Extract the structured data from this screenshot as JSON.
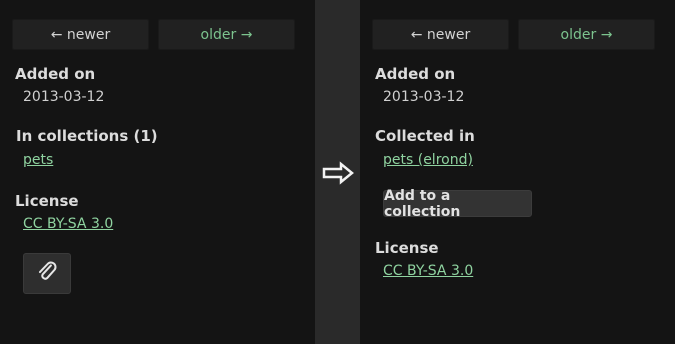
{
  "left": {
    "nav": {
      "newer": "← newer",
      "older": "older →"
    },
    "added_on": {
      "heading": "Added on",
      "value": "2013-03-12"
    },
    "collections": {
      "heading": "In collections (1)",
      "link": "pets"
    },
    "license": {
      "heading": "License",
      "link": "CC BY-SA 3.0"
    },
    "attach_icon": "paperclip-icon"
  },
  "right": {
    "nav": {
      "newer": "← newer",
      "older": "older →"
    },
    "added_on": {
      "heading": "Added on",
      "value": "2013-03-12"
    },
    "collections": {
      "heading": "Collected in",
      "link": "pets (elrond)",
      "button": "Add to a collection"
    },
    "license": {
      "heading": "License",
      "link": "CC BY-SA 3.0"
    }
  },
  "divider_icon": "right-arrow-icon",
  "colors": {
    "link": "#8fd3a0",
    "older_nav": "#7cc48e",
    "panel_bg": "#141414",
    "divider_bg": "#2a2a2a"
  }
}
